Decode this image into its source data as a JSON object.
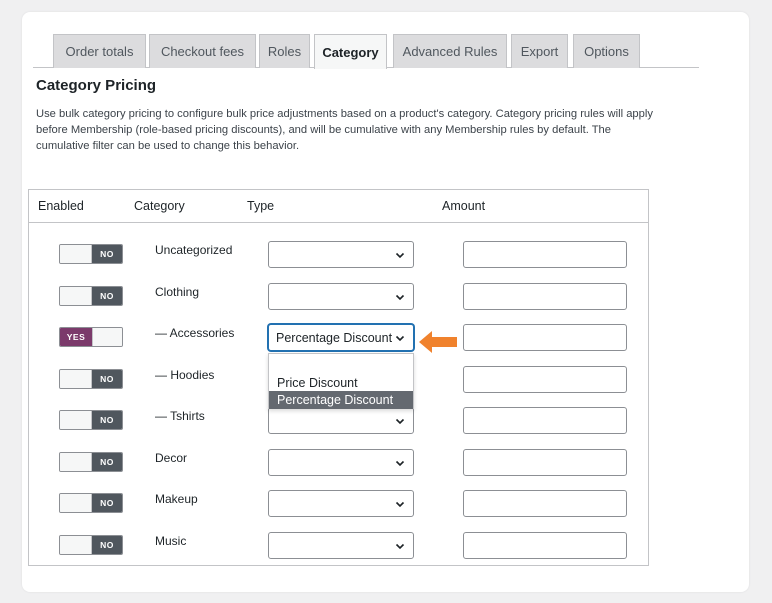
{
  "tabs": [
    "Order totals",
    "Checkout fees",
    "Roles",
    "Category",
    "Advanced Rules",
    "Export",
    "Options"
  ],
  "active_tab": "Category",
  "section": {
    "title": "Category Pricing",
    "description_lines": [
      "Use bulk category pricing to configure bulk price adjustments based on a product's category. Category pricing rules will apply",
      "before Membership (role-based pricing discounts), and will be cumulative with any Membership rules by default. The",
      "cumulative filter can be used to change this behavior."
    ]
  },
  "table": {
    "headers": [
      "Enabled",
      "Category",
      "Type",
      "Amount"
    ],
    "toggle_labels": {
      "on": "YES",
      "off": "NO"
    },
    "rows": [
      {
        "category": "Uncategorized",
        "enabled": false,
        "type": "",
        "amount": ""
      },
      {
        "category": "Clothing",
        "enabled": false,
        "type": "",
        "amount": ""
      },
      {
        "category": "— Accessories",
        "enabled": true,
        "type": "Percentage Discount",
        "amount": ""
      },
      {
        "category": "— Hoodies",
        "enabled": false,
        "type": "",
        "amount": ""
      },
      {
        "category": "— Tshirts",
        "enabled": false,
        "type": "",
        "amount": ""
      },
      {
        "category": "Decor",
        "enabled": false,
        "type": "",
        "amount": ""
      },
      {
        "category": "Makeup",
        "enabled": false,
        "type": "",
        "amount": ""
      },
      {
        "category": "Music",
        "enabled": false,
        "type": "",
        "amount": ""
      }
    ]
  },
  "dropdown": {
    "options": [
      "",
      "Price Discount",
      "Percentage Discount"
    ],
    "highlighted": "Percentage Discount"
  },
  "colors": {
    "toggle_on": "#7b3a6b",
    "toggle_off": "#50575e",
    "focus": "#2271b1",
    "arrow": "#f0822d"
  },
  "icons": {
    "select": "chevron-down-icon",
    "pointer": "arrow-left-icon"
  }
}
